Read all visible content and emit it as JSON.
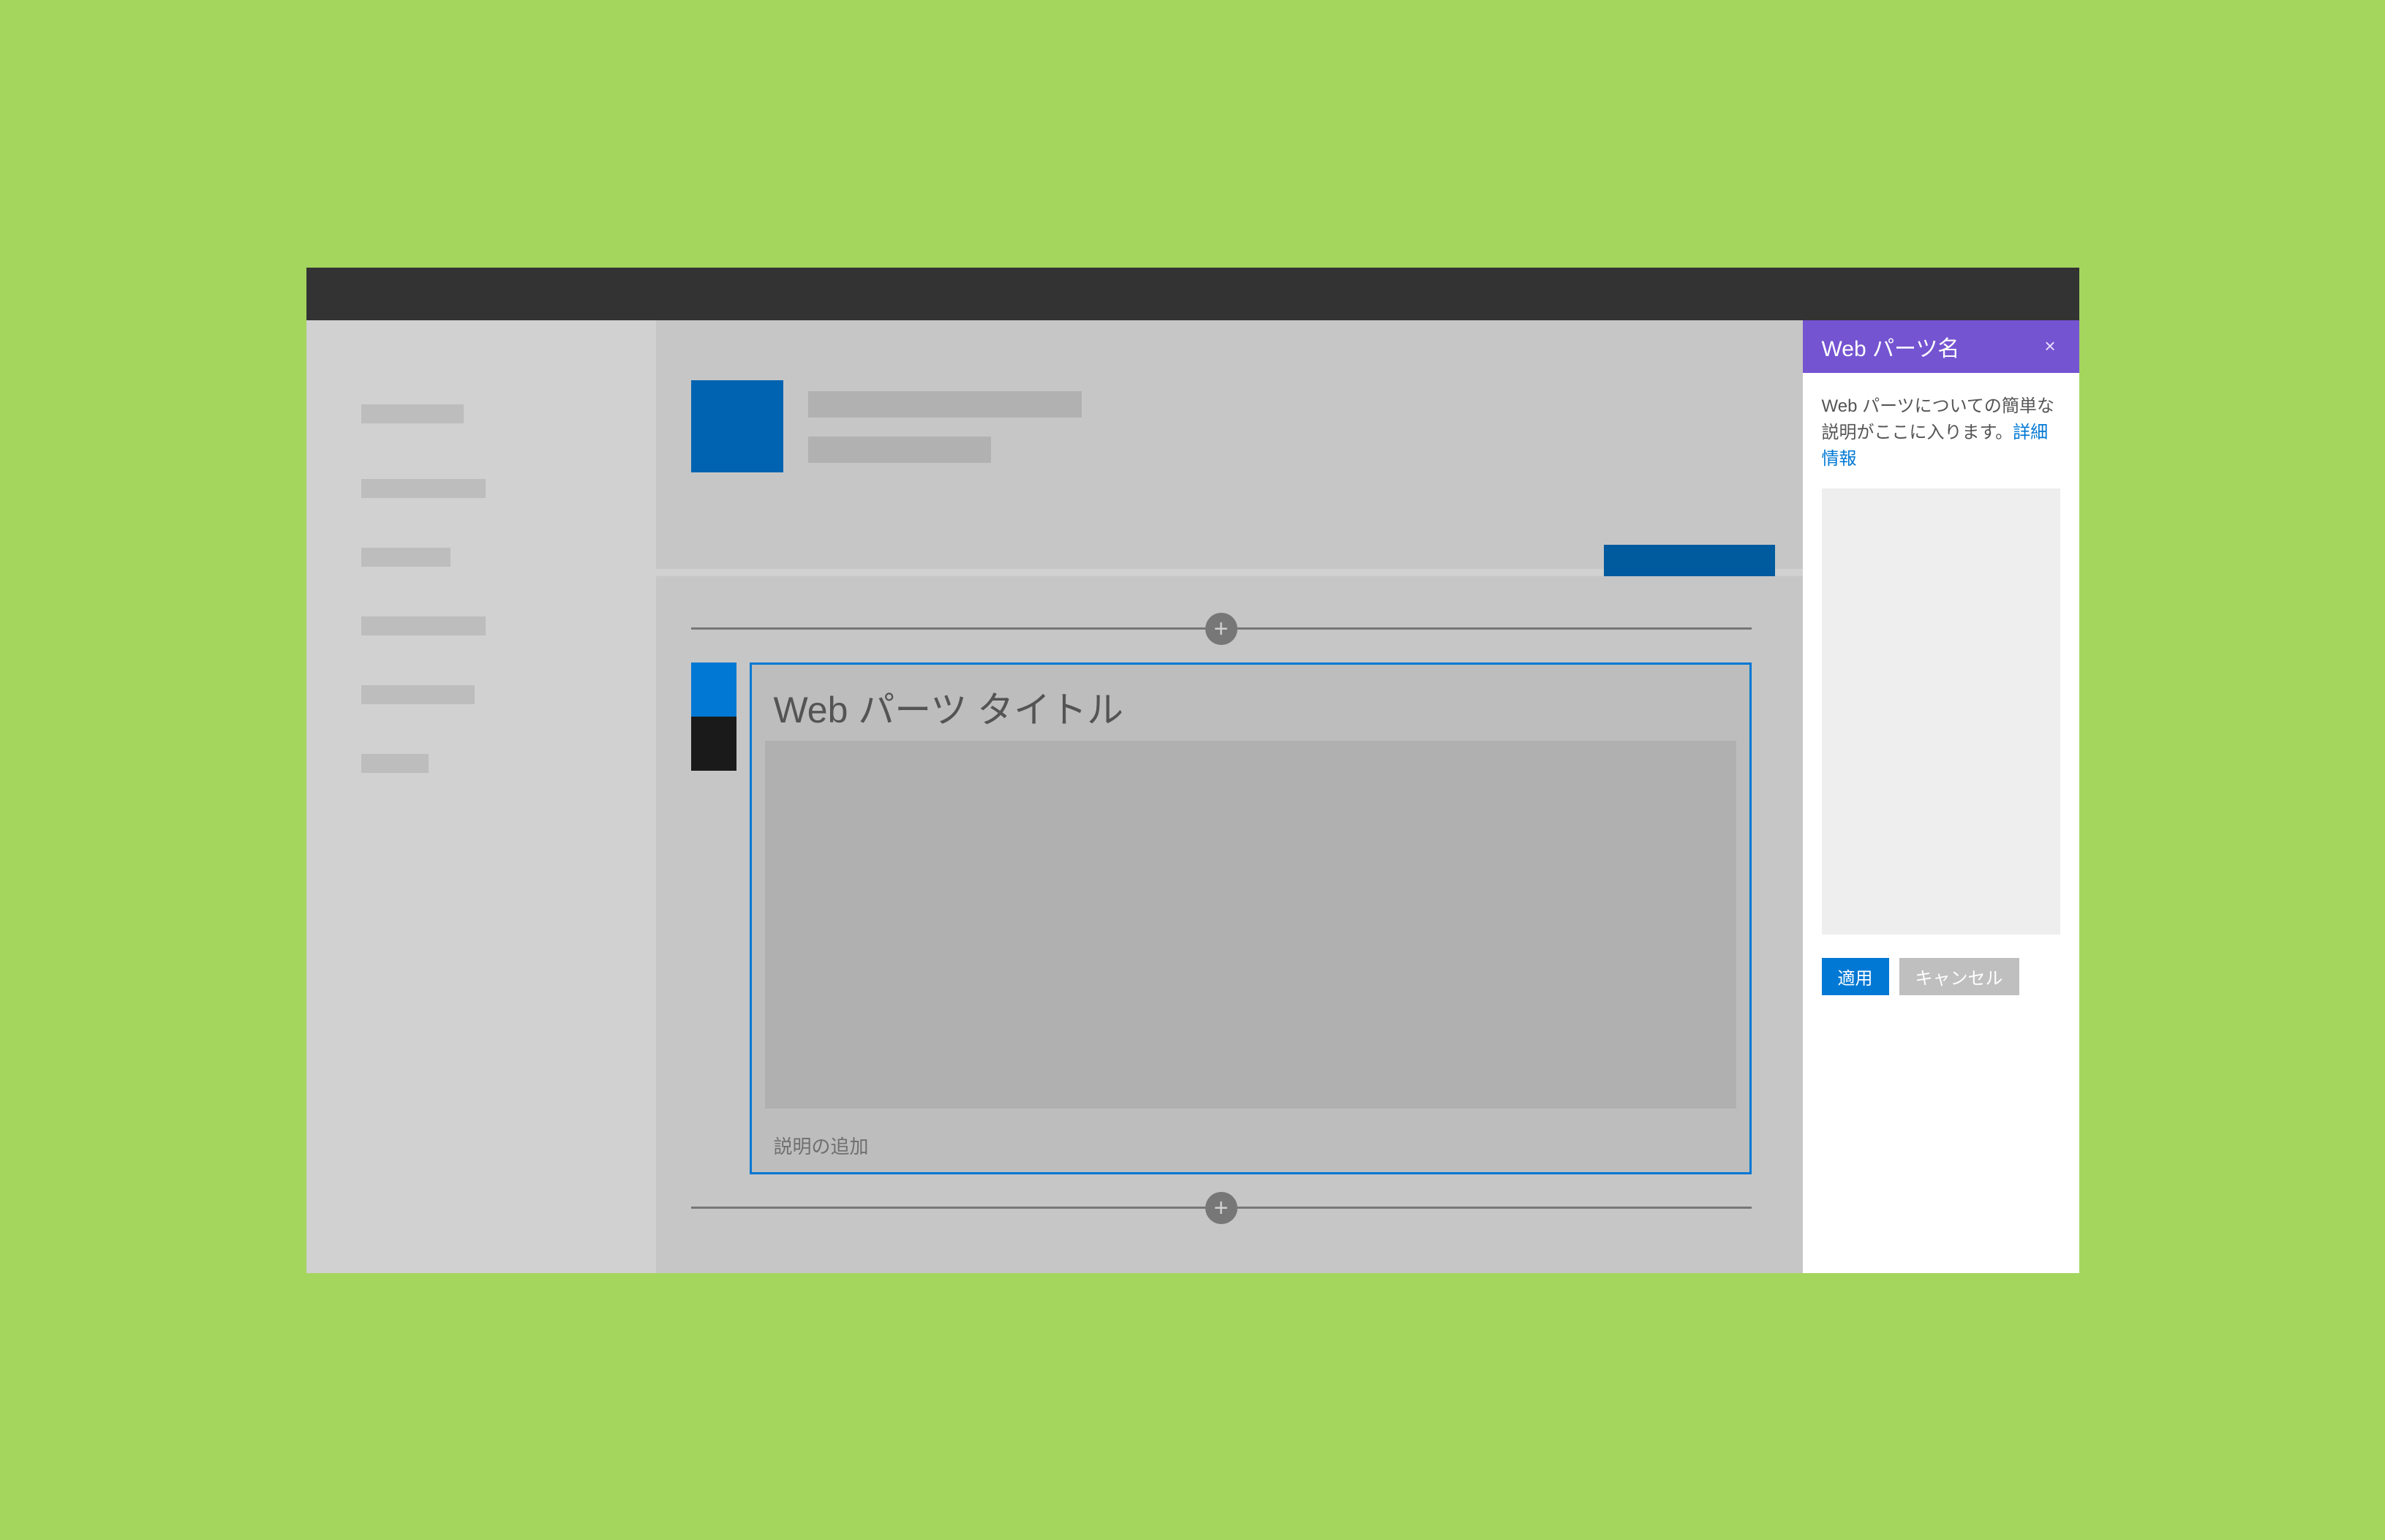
{
  "canvas": {
    "webpart_title": "Web パーツ タイトル",
    "add_description": "説明の追加"
  },
  "panel": {
    "title": "Web パーツ名",
    "description_prefix": "Web パーツについての簡単な説明がここに入ります。",
    "learn_more": "詳細情報",
    "apply_label": "適用",
    "cancel_label": "キャンセル"
  },
  "icons": {
    "plus": "+",
    "close": "×"
  }
}
